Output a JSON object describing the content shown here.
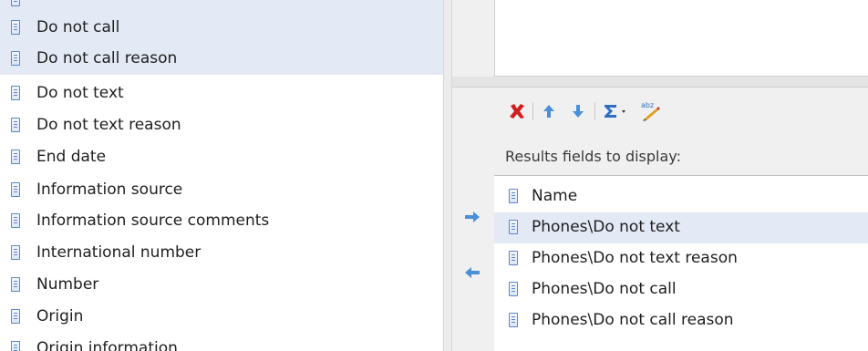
{
  "left_list": {
    "items": [
      {
        "label": "Do not call",
        "selected": true
      },
      {
        "label": "Do not call reason",
        "selected": true
      },
      {
        "label": "Do not text",
        "selected": false
      },
      {
        "label": "Do not text reason",
        "selected": false
      },
      {
        "label": "End date",
        "selected": false
      },
      {
        "label": "Information source",
        "selected": false
      },
      {
        "label": "Information source comments",
        "selected": false
      },
      {
        "label": "International number",
        "selected": false
      },
      {
        "label": "Number",
        "selected": false
      },
      {
        "label": "Origin",
        "selected": false
      },
      {
        "label": "Origin information",
        "selected": false
      }
    ]
  },
  "toolbar": {
    "delete_icon": "red-x-icon",
    "move_up_icon": "arrow-up-icon",
    "move_down_icon": "arrow-down-icon",
    "sigma_icon": "sigma-icon",
    "sort_icon": "abz-sort-icon"
  },
  "results": {
    "label": "Results fields to display:",
    "items": [
      {
        "label": "Name",
        "selected": false
      },
      {
        "label": "Phones\\Do not text",
        "selected": true
      },
      {
        "label": "Phones\\Do not text reason",
        "selected": false
      },
      {
        "label": "Phones\\Do not call",
        "selected": false
      },
      {
        "label": "Phones\\Do not call reason",
        "selected": false
      }
    ]
  },
  "transfer": {
    "add_icon": "arrow-right-icon",
    "remove_icon": "arrow-left-icon"
  },
  "colors": {
    "selection": "#e3e9f5",
    "arrow_blue": "#4a90d9",
    "delete_red": "#d11f1f"
  }
}
